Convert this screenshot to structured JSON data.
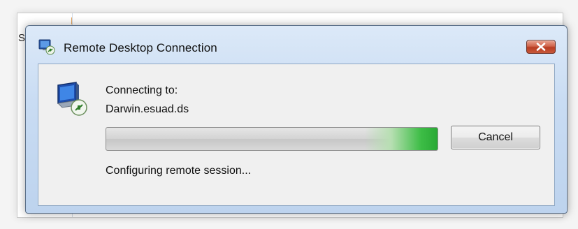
{
  "background": {
    "partial_letter": "S"
  },
  "dialog": {
    "title": "Remote Desktop Connection",
    "close_icon": "close-icon",
    "app_icon": "remote-desktop-icon"
  },
  "content": {
    "connecting_label": "Connecting to:",
    "server_name": "Darwin.esuad.ds",
    "progress": {
      "style": "marquee",
      "accent_color": "#2fb13b"
    },
    "cancel_label": "Cancel",
    "status_text": "Configuring remote session..."
  }
}
